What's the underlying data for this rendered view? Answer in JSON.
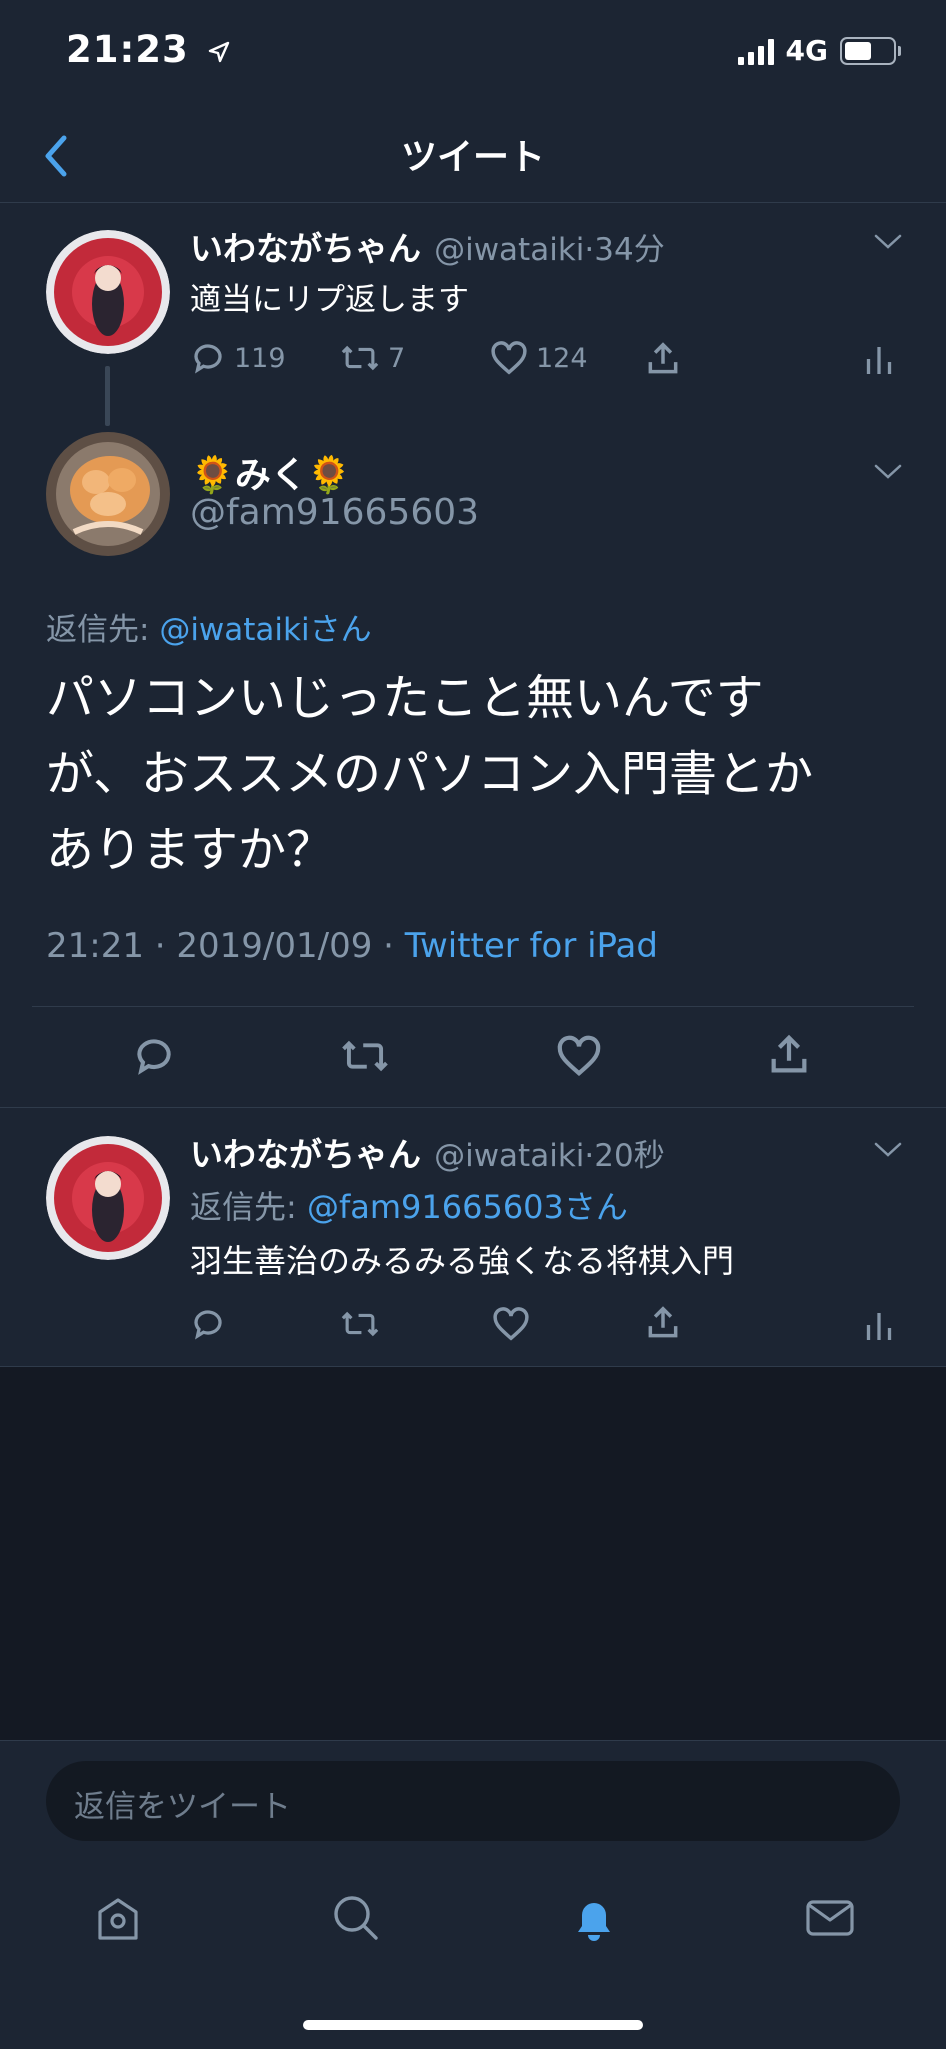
{
  "status": {
    "time": "21:23",
    "network": "4G"
  },
  "nav": {
    "title": "ツイート"
  },
  "parent_tweet": {
    "name": "いわながちゃん",
    "handle": "@iwataiki",
    "dot": "·",
    "time": "34分",
    "text": "適当にリプ返します",
    "replies": "119",
    "retweets": "7",
    "likes": "124"
  },
  "main_tweet": {
    "name": "🌻みく🌻",
    "handle": "@fam91665603",
    "reply_prefix": "返信先: ",
    "reply_to": "@iwataikiさん",
    "text_line1": "パソコンいじったこと無いんです",
    "text_line2": "が、おススメのパソコン入門書とか",
    "text_line3": "ありますか？",
    "timestamp": "21:21 · 2019/01/09 · ",
    "source": "Twitter for iPad"
  },
  "reply_tweet": {
    "name": "いわながちゃん",
    "handle": "@iwataiki",
    "dot": "·",
    "time": "20秒",
    "reply_prefix": "返信先: ",
    "reply_to": "@fam91665603さん",
    "text": "羽生善治のみるみる強くなる将棋入門"
  },
  "composer": {
    "placeholder": "返信をツイート"
  },
  "colors": {
    "accent": "#4ba3ec",
    "background": "#1c2533",
    "muted": "#8596a8"
  },
  "tabs": [
    {
      "icon": "home-icon"
    },
    {
      "icon": "search-icon"
    },
    {
      "icon": "notifications-icon",
      "active": true
    },
    {
      "icon": "messages-icon"
    }
  ]
}
